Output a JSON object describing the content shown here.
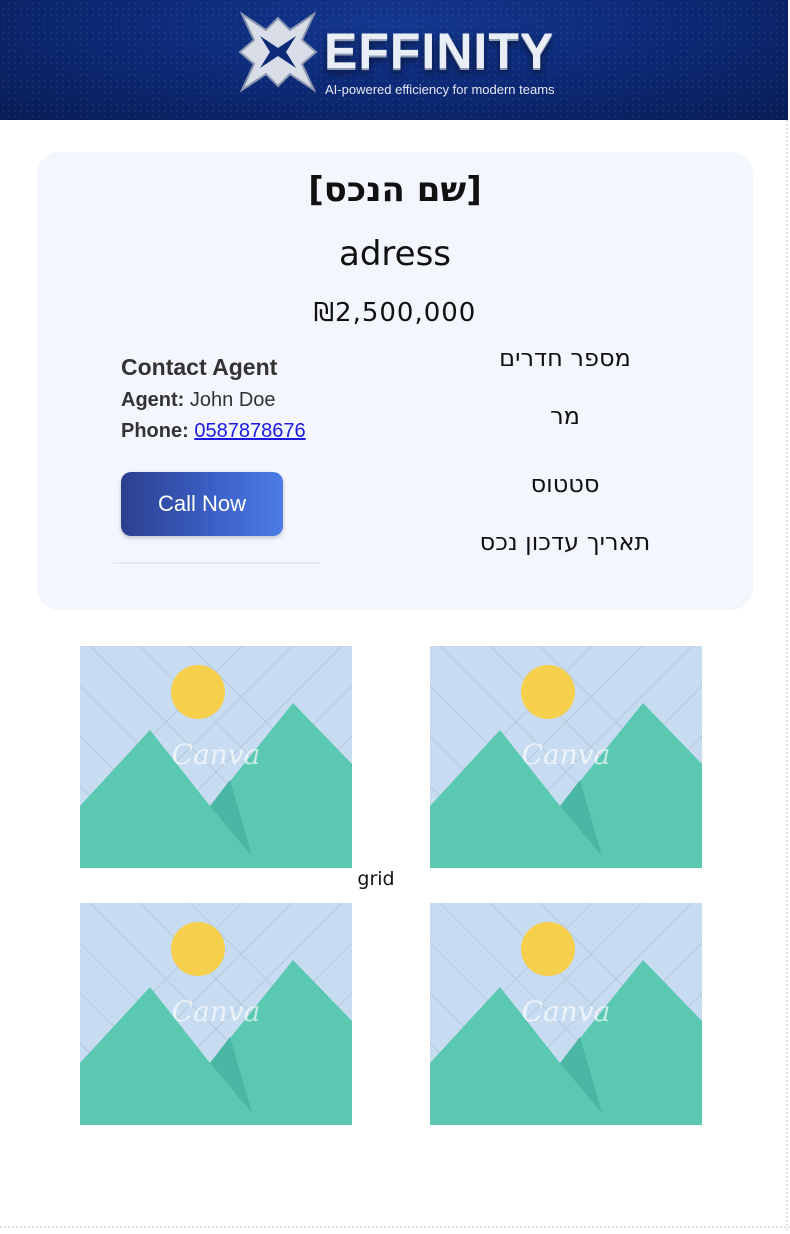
{
  "header": {
    "brand_name": "EFFINITY",
    "tagline": "AI-powered efficiency for modern teams"
  },
  "property": {
    "name": "[שם הנכס]",
    "address": "adress",
    "price": "₪2,500,000",
    "details": [
      "מספר חדרים",
      "מר",
      "סטטוס",
      "תאריך עדכון נכס"
    ]
  },
  "agent": {
    "title": "Contact Agent",
    "agent_label": "Agent:",
    "agent_name": "John Doe",
    "phone_label": "Phone:",
    "phone_number": "0587878676",
    "call_button": "Call Now"
  },
  "gallery": {
    "label": "grid",
    "images": [
      {
        "watermark": "Canva"
      },
      {
        "watermark": "Canva"
      },
      {
        "watermark": "Canva"
      },
      {
        "watermark": "Canva"
      }
    ]
  },
  "colors": {
    "banner": "#0d2a78",
    "card_bg": "#f3f6fd",
    "button_start": "#2c3f8e",
    "button_end": "#4d7ce6",
    "link": "#1a1ae0",
    "placeholder_sky": "#c8dcf1",
    "placeholder_mountain": "#5bc8b2",
    "placeholder_sun": "#f6d04d"
  },
  "icons": [
    "effinity-logo-icon"
  ]
}
